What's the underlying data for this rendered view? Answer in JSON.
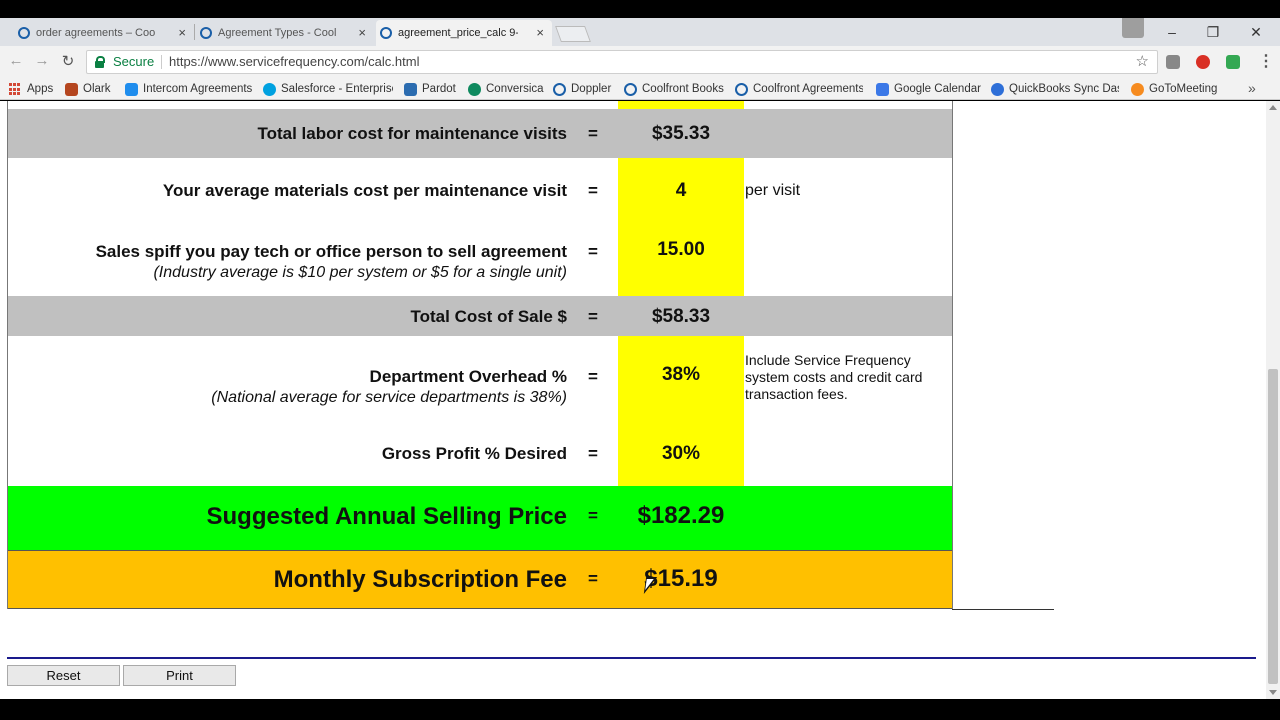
{
  "browser": {
    "tabs": [
      {
        "title": "order agreements – Cool",
        "active": false
      },
      {
        "title": "Agreement Types - Cool",
        "active": false
      },
      {
        "title": "agreement_price_calc 9-",
        "active": true
      }
    ],
    "close_glyph": "×",
    "window_controls": {
      "minimize": "–",
      "restore": "❐",
      "close": "✕"
    },
    "nav": {
      "back": "←",
      "forward": "→",
      "reload": "↻"
    },
    "secure_label": "Secure",
    "url": "https://www.servicefrequency.com/calc.html",
    "star": "☆",
    "menu": "⋮",
    "bookmarks": [
      {
        "label": "Apps",
        "icon": "apps-grid-icon"
      },
      {
        "label": "Olark",
        "icon": "olark-icon",
        "color": "#b5461f"
      },
      {
        "label": "Intercom Agreements",
        "icon": "intercom-icon",
        "color": "#1f8ded"
      },
      {
        "label": "Salesforce - Enterprise",
        "icon": "salesforce-icon",
        "color": "#00a1e0"
      },
      {
        "label": "Pardot",
        "icon": "pardot-icon",
        "color": "#2b6cb0"
      },
      {
        "label": "Conversica",
        "icon": "conversica-icon",
        "color": "#0f8a5f"
      },
      {
        "label": "Doppler",
        "icon": "doppler-icon",
        "color": "#1a5fa8"
      },
      {
        "label": "Coolfront Books",
        "icon": "coolfront-icon",
        "color": "#1a5fa8"
      },
      {
        "label": "Coolfront Agreements",
        "icon": "coolfront-icon",
        "color": "#1a5fa8"
      },
      {
        "label": "Google Calendar",
        "icon": "calendar-icon",
        "color": "#3b78e7"
      },
      {
        "label": "QuickBooks Sync Dash",
        "icon": "quickbooks-icon",
        "color": "#2e6fd8"
      },
      {
        "label": "GoToMeeting",
        "icon": "gotomeeting-icon",
        "color": "#f68b1f"
      }
    ],
    "bookmarks_more": "»"
  },
  "calc": {
    "rows": [
      {
        "label": "Total labor cost for maintenance visits",
        "eq": "=",
        "value": "$35.33"
      },
      {
        "label": "Your average materials cost per maintenance visit",
        "eq": "=",
        "value": "4",
        "note": "per visit"
      },
      {
        "label": "Sales spiff you pay tech or office person to sell agreement",
        "sublabel": "(Industry average is $10 per system or $5 for a single unit)",
        "eq": "=",
        "value": "15.00"
      },
      {
        "label": "Total Cost of Sale $",
        "eq": "=",
        "value": "$58.33"
      },
      {
        "label": "Department Overhead %",
        "sublabel": "(National average for service departments is 38%)",
        "eq": "=",
        "value": "38%",
        "note": "Include Service Frequency system costs and credit card transaction fees."
      },
      {
        "label": "Gross Profit % Desired",
        "eq": "=",
        "value": "30%"
      },
      {
        "label": "Suggested Annual Selling Price",
        "eq": "=",
        "value": "$182.29"
      },
      {
        "label": "Monthly Subscription Fee",
        "eq": "=",
        "value": "$15.19"
      }
    ]
  },
  "buttons": {
    "reset": "Reset",
    "print": "Print"
  },
  "colors": {
    "yellow": "#ffff00",
    "gray_row": "#c0c0c0",
    "green_row": "#00ff00",
    "orange_row": "#ffc000",
    "rule": "#1a1a8c"
  }
}
